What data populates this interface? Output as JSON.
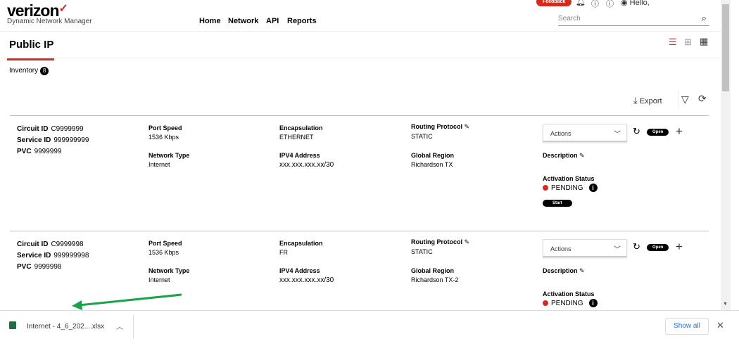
{
  "header": {
    "logo": "verizon",
    "logo_check": "✓",
    "subtitle": "Dynamic Network Manager",
    "nav": [
      "Home",
      "Network",
      "API",
      "Reports"
    ],
    "feedback": "Feedback",
    "greeting": "Hello,",
    "search_placeholder": "Search"
  },
  "page": {
    "title": "Public IP",
    "inventory_label": "Inventory",
    "inventory_count": "8",
    "export": "Export"
  },
  "labels": {
    "circuit": "Circuit ID",
    "service": "Service ID",
    "pvc": "PVC",
    "port_speed": "Port Speed",
    "network_type": "Network Type",
    "encapsulation": "Encapsulation",
    "ipv4": "IPV4 Address",
    "routing": "Routing Protocol",
    "region": "Global Region",
    "actions": "Actions",
    "open": "Open",
    "description": "Description",
    "activation": "Activation Status",
    "start": "Start"
  },
  "records": [
    {
      "circuit_id": "C9999999",
      "service_id": "999999999",
      "pvc": "9999999",
      "port_speed": "1536 Kbps",
      "network_type": "Internet",
      "encapsulation": "ETHERNET",
      "ipv4": "xxx.xxx.xxx.xx/30",
      "routing": "STATIC",
      "region": "Richardson TX",
      "status": "PENDING"
    },
    {
      "circuit_id": "C9999998",
      "service_id": "999999998",
      "pvc": "9999998",
      "port_speed": "1536 Kbps",
      "network_type": "Internet",
      "encapsulation": "FR",
      "ipv4": "xxx.xxx.xxx.xx/30",
      "routing": "STATIC",
      "region": "Richardson TX-2",
      "status": "PENDING"
    }
  ],
  "download": {
    "filename": "Internet - 4_6_202....xlsx",
    "show_all": "Show all"
  },
  "colors": {
    "accent": "#d52b1e",
    "arrow": "#1aa34a"
  }
}
